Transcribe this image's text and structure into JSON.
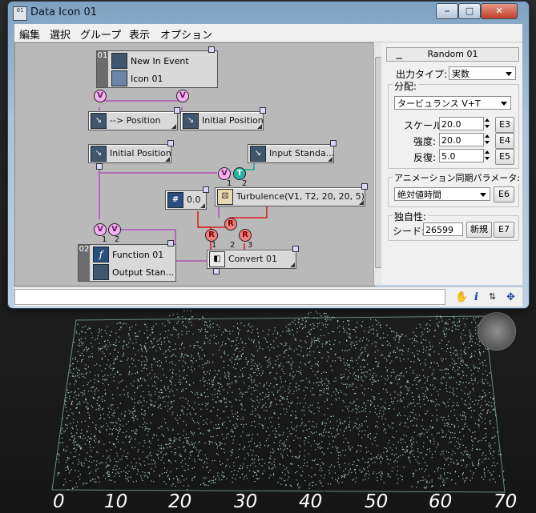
{
  "window": {
    "title": "Data Icon 01",
    "controls": [
      "⎯",
      "□",
      "✕"
    ]
  },
  "app_icon": "01",
  "menu": [
    "編集",
    "選択",
    "グループ",
    "表示",
    "オプション"
  ],
  "graph": {
    "event": {
      "number": "01",
      "title": "New In Event",
      "icon_label": "Icon 01"
    },
    "nodes": {
      "pos_arrow": "--> Position",
      "initial_pos_top": "Initial Position",
      "initial_pos_left": "Initial Position",
      "input_standard": "Input Standa...",
      "scalar": "0.0",
      "turbulence": "Turbulence(V1, T2, 20, 20, 5)",
      "convert": "Convert 01"
    },
    "function": {
      "number": "02",
      "title": "Function 01",
      "output": "Output Stan..."
    },
    "circles": {
      "v": "V",
      "t": "T",
      "r": "R"
    },
    "port_numbers": {
      "one": "1",
      "two": "2",
      "three": "3"
    }
  },
  "right_panel": {
    "header": "Random 01",
    "collapse": "−",
    "output_type_label": "出力タイプ:",
    "output_type_value": "実数",
    "distribution_group": "分配:",
    "distribution_value": "タービュランス V+T",
    "scale_label": "スケール:",
    "scale_value": "20.0",
    "scale_btn": "E3",
    "strength_label": "強度:",
    "strength_value": "20.0",
    "strength_btn": "E4",
    "repeat_label": "反復:",
    "repeat_value": "5.0",
    "repeat_btn": "E5",
    "anim_group": "アニメーション同期パラメータ:",
    "anim_value": "絶対値時間",
    "anim_btn": "E6",
    "unique_group": "独自性:",
    "seed_label": "シード:",
    "seed_value": "26599",
    "new_btn": "新規",
    "seed_btn": "E7"
  },
  "status_icons": [
    "hand-icon",
    "info-icon",
    "arrange-icon",
    "pin-icon"
  ],
  "viewport": {
    "axis_labels": [
      "0",
      "10",
      "20",
      "30",
      "40",
      "50",
      "60",
      "70"
    ]
  },
  "colors": {
    "wire_purple": "#b040b8",
    "wire_red": "#e00000",
    "wire_teal": "#00a090"
  }
}
